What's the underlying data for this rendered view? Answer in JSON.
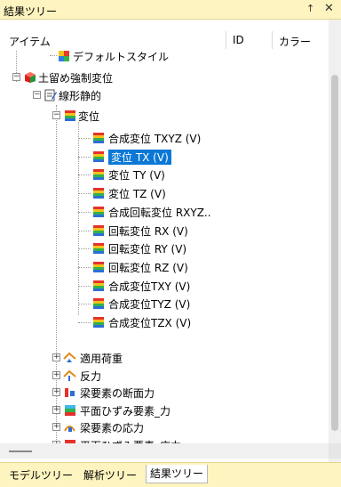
{
  "window": {
    "title": "結果ツリー",
    "pin_glyph": "ᵖ",
    "close_glyph": "✕"
  },
  "columns": {
    "item": "アイテム",
    "id": "ID",
    "color": "カラー"
  },
  "tree": {
    "default_style": "デフォルトスタイル",
    "root": "土留め強制変位",
    "analysis": "線形静的",
    "displacement": "変位",
    "disp_items": [
      "合成変位 TXYZ (V)",
      "変位 TX (V)",
      "変位 TY (V)",
      "変位 TZ (V)",
      "合成回転変位 RXYZ..",
      "回転変位 RX (V)",
      "回転変位 RY (V)",
      "回転変位 RZ (V)",
      "合成変位TXY (V)",
      "合成変位TYZ (V)",
      "合成変位TZX (V)"
    ],
    "other_items": [
      "適用荷重",
      "反力",
      "梁要素の断面力",
      "平面ひずみ要素_力",
      "梁要素の応力",
      "平面ひずみ要素_応力"
    ],
    "selected_index": 1
  },
  "tabs": [
    "モデルツリー",
    "解析ツリー",
    "結果ツリー"
  ],
  "active_tab": 2,
  "colors": {
    "selection": "#0b78d6",
    "tab_bar": "#fdf4bf"
  }
}
